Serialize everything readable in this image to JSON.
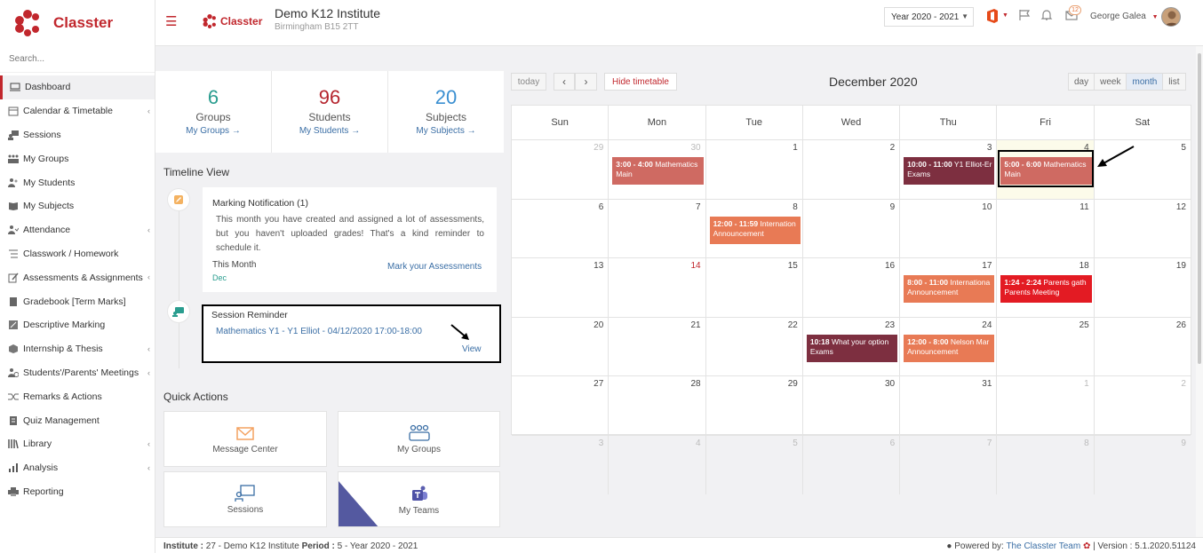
{
  "brand": {
    "name": "Classter",
    "accent": "#c1272d"
  },
  "sidebar": {
    "search_placeholder": "Search...",
    "items": [
      {
        "label": "Dashboard",
        "icon": "monitor-icon",
        "active": true,
        "chevron": false
      },
      {
        "label": "Calendar & Timetable",
        "icon": "calendar-icon",
        "chevron": true
      },
      {
        "label": "Sessions",
        "icon": "sessions-icon",
        "chevron": false
      },
      {
        "label": "My Groups",
        "icon": "groups-icon",
        "chevron": false
      },
      {
        "label": "My Students",
        "icon": "students-icon",
        "chevron": false
      },
      {
        "label": "My Subjects",
        "icon": "book-icon",
        "chevron": false
      },
      {
        "label": "Attendance",
        "icon": "attendance-icon",
        "chevron": true
      },
      {
        "label": "Classwork / Homework",
        "icon": "list-icon",
        "chevron": false
      },
      {
        "label": "Assessments & Assignments",
        "icon": "edit-icon",
        "chevron": true
      },
      {
        "label": "Gradebook [Term Marks]",
        "icon": "gradebook-icon",
        "chevron": false
      },
      {
        "label": "Descriptive Marking",
        "icon": "marking-icon",
        "chevron": false
      },
      {
        "label": "Internship & Thesis",
        "icon": "box-icon",
        "chevron": true
      },
      {
        "label": "Students'/Parents' Meetings",
        "icon": "meeting-icon",
        "chevron": true
      },
      {
        "label": "Remarks & Actions",
        "icon": "shuffle-icon",
        "chevron": false
      },
      {
        "label": "Quiz Management",
        "icon": "quiz-icon",
        "chevron": false
      },
      {
        "label": "Library",
        "icon": "library-icon",
        "chevron": true
      },
      {
        "label": "Analysis",
        "icon": "chart-icon",
        "chevron": true
      },
      {
        "label": "Reporting",
        "icon": "printer-icon",
        "chevron": false
      }
    ]
  },
  "header": {
    "institute_name": "Demo K12 Institute",
    "institute_city": "Birmingham B15 2TT",
    "year_label": "Year 2020 - 2021",
    "notif_count": "12",
    "user_name": "George Galea"
  },
  "stats": [
    {
      "num": "6",
      "label": "Groups",
      "link": "My Groups",
      "color": "#2a9d8f"
    },
    {
      "num": "96",
      "label": "Students",
      "link": "My Students",
      "color": "#b5252e"
    },
    {
      "num": "20",
      "label": "Subjects",
      "link": "My Subjects",
      "color": "#3a8fd1"
    }
  ],
  "timeline": {
    "title": "Timeline View",
    "marking": {
      "title": "Marking Notification (1)",
      "body": "This month you have created and assigned a lot of assessments, but you haven't uploaded grades! That's a kind reminder to schedule it.",
      "when": "This Month",
      "month": "Dec",
      "link": "Mark your Assessments"
    },
    "session": {
      "title": "Session Reminder",
      "link": "Mathematics Y1 - Y1 Elliot - 04/12/2020 17:00-18:00",
      "view": "View"
    }
  },
  "quick_actions": {
    "title": "Quick Actions",
    "items": [
      "Message Center",
      "My Groups",
      "Sessions",
      "My Teams"
    ]
  },
  "calendar": {
    "today_btn": "today",
    "hide_btn": "Hide timetable",
    "title": "December 2020",
    "views": [
      "day",
      "week",
      "month",
      "list"
    ],
    "weekdays": [
      "Sun",
      "Mon",
      "Tue",
      "Wed",
      "Thu",
      "Fri",
      "Sat"
    ],
    "weeks": [
      [
        {
          "d": "29",
          "other": true
        },
        {
          "d": "30",
          "other": true
        },
        {
          "d": "1"
        },
        {
          "d": "2"
        },
        {
          "d": "3"
        },
        {
          "d": "4",
          "today": true
        },
        {
          "d": "5"
        }
      ],
      [
        {
          "d": "6"
        },
        {
          "d": "7"
        },
        {
          "d": "8"
        },
        {
          "d": "9"
        },
        {
          "d": "10"
        },
        {
          "d": "11"
        },
        {
          "d": "12"
        }
      ],
      [
        {
          "d": "13"
        },
        {
          "d": "14",
          "red": true
        },
        {
          "d": "15"
        },
        {
          "d": "16"
        },
        {
          "d": "17"
        },
        {
          "d": "18"
        },
        {
          "d": "19"
        }
      ],
      [
        {
          "d": "20"
        },
        {
          "d": "21"
        },
        {
          "d": "22"
        },
        {
          "d": "23"
        },
        {
          "d": "24"
        },
        {
          "d": "25"
        },
        {
          "d": "26"
        }
      ],
      [
        {
          "d": "27"
        },
        {
          "d": "28"
        },
        {
          "d": "29"
        },
        {
          "d": "30"
        },
        {
          "d": "31"
        },
        {
          "d": "1",
          "other": true
        },
        {
          "d": "2",
          "other": true
        }
      ],
      [
        {
          "d": "3",
          "other": true
        },
        {
          "d": "4",
          "other": true
        },
        {
          "d": "5",
          "other": true
        },
        {
          "d": "6",
          "other": true
        },
        {
          "d": "7",
          "other": true
        },
        {
          "d": "8",
          "other": true
        },
        {
          "d": "9",
          "other": true
        }
      ]
    ],
    "events": [
      {
        "week": 0,
        "day": 1,
        "time": "3:00 - 4:00",
        "title": "Mathematics",
        "sub": "Main",
        "color": "#cf6a62"
      },
      {
        "week": 0,
        "day": 4,
        "time": "10:00 - 11:00",
        "title": "Y1 Elliot-Er",
        "sub": "Exams",
        "color": "#7d2f40"
      },
      {
        "week": 0,
        "day": 5,
        "time": "5:00 - 6:00",
        "title": "Mathematics",
        "sub": "Main",
        "color": "#cf6a62"
      },
      {
        "week": 1,
        "day": 2,
        "time": "12:00 - 11:59",
        "title": "Internation",
        "sub": "Announcement",
        "color": "#e87a55"
      },
      {
        "week": 2,
        "day": 4,
        "time": "8:00 - 11:00",
        "title": "Internationa",
        "sub": "Announcement",
        "color": "#e87a55"
      },
      {
        "week": 2,
        "day": 5,
        "time": "1:24 - 2:24",
        "title": "Parents gath",
        "sub": "Parents Meeting",
        "color": "#e31b23"
      },
      {
        "week": 3,
        "day": 3,
        "time": "10:18",
        "title": "What your option",
        "sub": "Exams",
        "color": "#7d2f40"
      },
      {
        "week": 3,
        "day": 4,
        "time": "12:00 - 8:00",
        "title": "Nelson Mar",
        "sub": "Announcement",
        "color": "#e87a55"
      }
    ]
  },
  "footer": {
    "inst_label": "Institute :",
    "inst_value": "27 - Demo K12 Institute",
    "period_label": "Period :",
    "period_value": "5 - Year 2020 - 2021",
    "powered": "Powered by:",
    "team": "The Classter Team",
    "version": "| Version : 5.1.2020.51124"
  }
}
